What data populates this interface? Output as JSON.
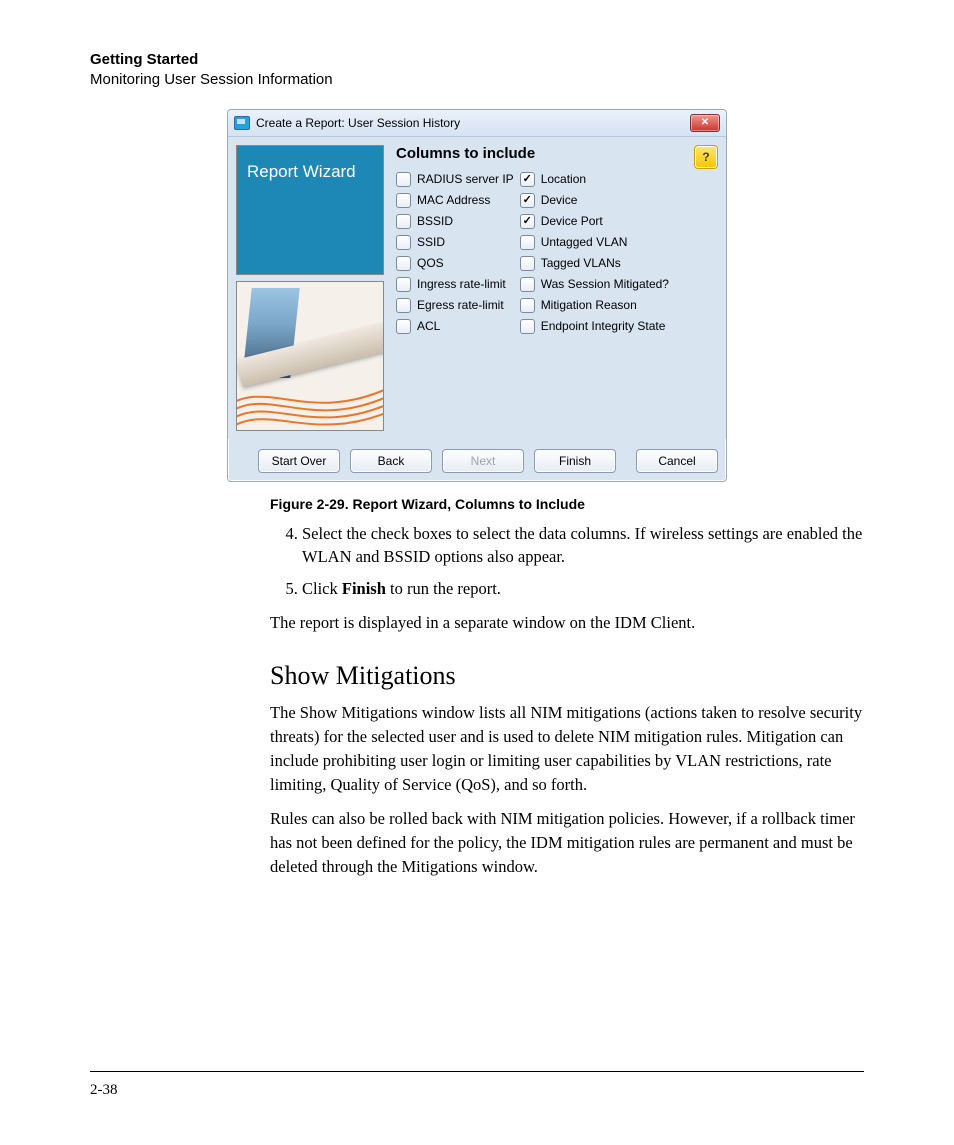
{
  "header": {
    "line1": "Getting Started",
    "line2": "Monitoring User Session Information"
  },
  "dialog": {
    "title": "Create a Report: User Session History",
    "close": "✕",
    "side_label": "Report Wizard",
    "section_heading": "Columns to include",
    "help": "?",
    "columns_left": [
      {
        "label": "RADIUS server IP",
        "checked": false
      },
      {
        "label": "MAC Address",
        "checked": false
      },
      {
        "label": "BSSID",
        "checked": false
      },
      {
        "label": "SSID",
        "checked": false
      },
      {
        "label": "QOS",
        "checked": false
      },
      {
        "label": "Ingress rate-limit",
        "checked": false
      },
      {
        "label": "Egress rate-limit",
        "checked": false
      },
      {
        "label": "ACL",
        "checked": false
      }
    ],
    "columns_right": [
      {
        "label": "Location",
        "checked": true
      },
      {
        "label": "Device",
        "checked": true
      },
      {
        "label": "Device Port",
        "checked": true
      },
      {
        "label": "Untagged VLAN",
        "checked": false
      },
      {
        "label": "Tagged VLANs",
        "checked": false
      },
      {
        "label": "Was Session Mitigated?",
        "checked": false
      },
      {
        "label": "Mitigation Reason",
        "checked": false
      },
      {
        "label": "Endpoint Integrity State",
        "checked": false
      }
    ],
    "buttons": {
      "start_over": "Start Over",
      "back": "Back",
      "next": "Next",
      "finish": "Finish",
      "cancel": "Cancel"
    }
  },
  "caption": "Figure 2-29. Report Wizard, Columns to Include",
  "steps": {
    "s4": "Select the check boxes to select the data columns. If wireless settings are enabled the WLAN and BSSID options also appear.",
    "s5_pre": "Click ",
    "s5_bold": "Finish",
    "s5_post": " to run the report."
  },
  "after_steps": "The report is displayed in a separate window on the IDM Client.",
  "section_title": "Show Mitigations",
  "p1": "The Show Mitigations window lists all NIM mitigations (actions taken to resolve security threats) for the selected user and is used to delete NIM mitigation rules. Mitigation can include prohibiting user login or limiting user capabilities by VLAN restrictions, rate limiting, Quality of Service (QoS), and so forth.",
  "p2": "Rules can also be rolled back with NIM mitigation policies. However, if a rollback timer has not been defined for the policy, the IDM mitigation rules are permanent and must be deleted through the Mitigations window.",
  "page_number": "2-38"
}
